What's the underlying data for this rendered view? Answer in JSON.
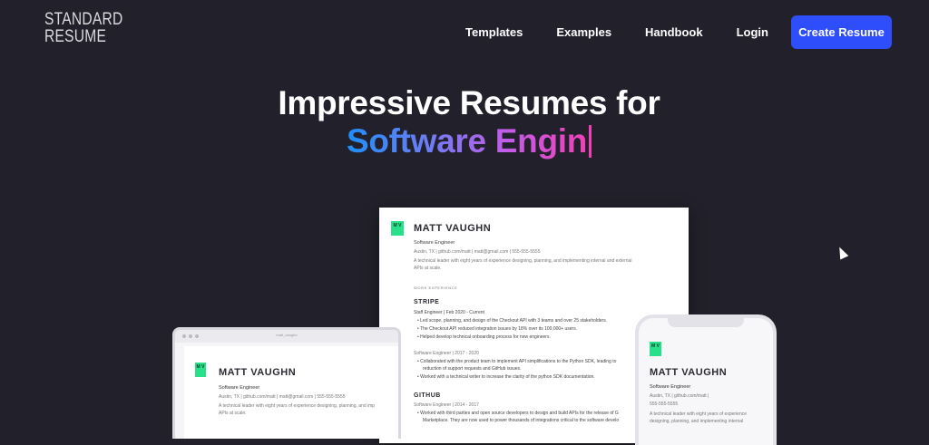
{
  "brand": {
    "line1": "STANDARD",
    "line2": "RESUME"
  },
  "nav": {
    "templates": "Templates",
    "examples": "Examples",
    "handbook": "Handbook",
    "login": "Login",
    "create": "Create Resume"
  },
  "hero": {
    "line1": "Impressive Resumes for",
    "line2": "Software Engin"
  },
  "resume": {
    "initials": "M V",
    "name": "MATT VAUGHN",
    "title": "Software Engineer",
    "contact": "Austin, TX | github.com/matt | matt@gmail.com | 555-555-5555",
    "summary1": "A technical leader with eight years of experience designing, planning, and implementing internal and external",
    "summary2": "APIs at scale.",
    "section": "WORK EXPERIENCE",
    "company1": "STRIPE",
    "role1": "Staff Engineer | Feb 2020 - Current",
    "b1": "Led scope, planning, and design of the Checkout API with 3 teams and over 25 stakeholders.",
    "b2": "The Checkout API reduced integration issues by 18% over its 100,000+ users.",
    "b3": "Helped develop technical onboarding process for new engineers.",
    "role2": "Software Engineer | 2017 - 2020",
    "b4": "Collaborated with the product team to implement API simplifications to the Python SDK, leading to",
    "b4b": "reduction of support requests and GitHub issues.",
    "b5": "Worked with a technical writer to increase the clarity of the python SDK documentation.",
    "company2": "GITHUB",
    "role3": "Software Engineer | 2014 - 2017",
    "b6": "Worked with third parties and open source developers to design and build APIs for the release of G",
    "b6b": "Marketplace. They are now used to power thousands of integrations critical to the software develo"
  },
  "laptop": {
    "tab": "matt_vaughn",
    "initials": "M V",
    "name": "MATT VAUGHN",
    "title": "Software Engineer",
    "contact": "Austin, TX | github.com/matt | matt@gmail.com | 555-555-5555",
    "summary1": "A technical leader with eight years of experience designing, planning, and imp",
    "summary2": "APIs at scale."
  },
  "phone": {
    "initials": "M V",
    "name": "MATT VAUGHN",
    "title": "Software Engineer",
    "contact1": "Austin, TX | github.com/matt |",
    "contact2": "555-555-5555",
    "summary1": "A technical leader with eight years of experience",
    "summary2": "designing, planning, and implementing internal"
  }
}
